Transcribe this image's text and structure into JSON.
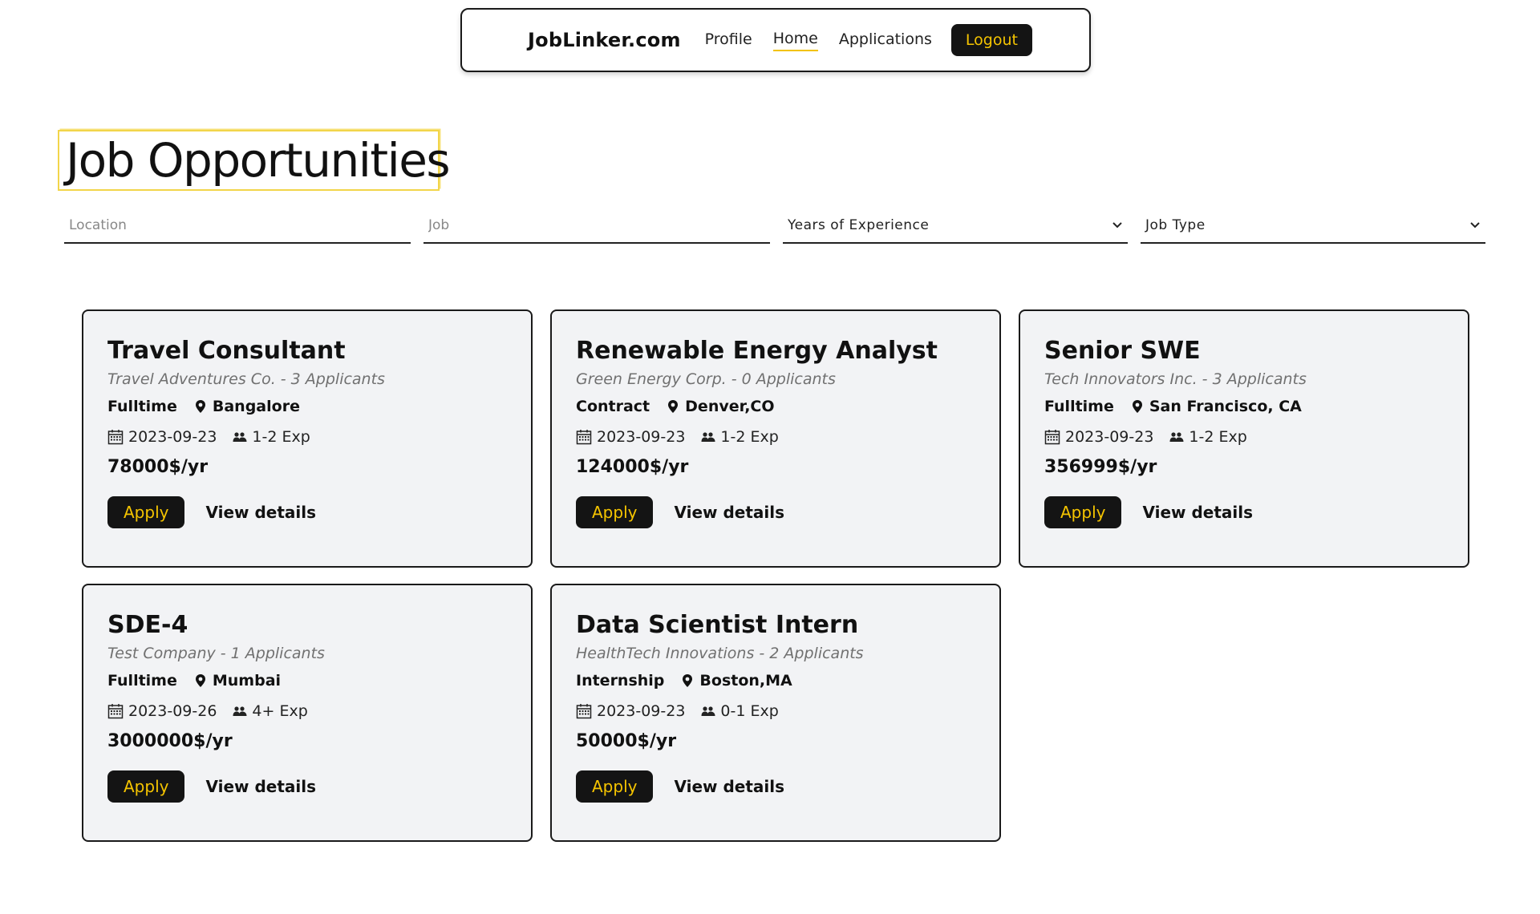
{
  "nav": {
    "brand": "JobLinker.com",
    "links": [
      "Profile",
      "Home",
      "Applications"
    ],
    "active": "Home",
    "logout": "Logout"
  },
  "page_title": "Job Opportunities",
  "filters": {
    "location_placeholder": "Location",
    "job_placeholder": "Job",
    "experience_label": "Years of Experience",
    "job_type_label": "Job Type"
  },
  "colors": {
    "accent": "#f5c400",
    "dark": "#141414",
    "card_bg": "#f2f3f5"
  },
  "jobs": [
    {
      "title": "Travel Consultant",
      "subtitle": "Travel Adventures Co. - 3 Applicants",
      "type": "Fulltime",
      "location": "Bangalore",
      "date": "2023-09-23",
      "exp": "1-2 Exp",
      "salary": "78000$/yr",
      "apply": "Apply",
      "details": "View details"
    },
    {
      "title": "Renewable Energy Analyst",
      "subtitle": "Green Energy Corp. - 0 Applicants",
      "type": "Contract",
      "location": "Denver,CO",
      "date": "2023-09-23",
      "exp": "1-2 Exp",
      "salary": "124000$/yr",
      "apply": "Apply",
      "details": "View details"
    },
    {
      "title": "Senior SWE",
      "subtitle": "Tech Innovators Inc. - 3 Applicants",
      "type": "Fulltime",
      "location": "San Francisco, CA",
      "date": "2023-09-23",
      "exp": "1-2 Exp",
      "salary": "356999$/yr",
      "apply": "Apply",
      "details": "View details"
    },
    {
      "title": "SDE-4",
      "subtitle": "Test Company - 1 Applicants",
      "type": "Fulltime",
      "location": "Mumbai",
      "date": "2023-09-26",
      "exp": "4+ Exp",
      "salary": "3000000$/yr",
      "apply": "Apply",
      "details": "View details"
    },
    {
      "title": "Data Scientist Intern",
      "subtitle": "HealthTech Innovations - 2 Applicants",
      "type": "Internship",
      "location": "Boston,MA",
      "date": "2023-09-23",
      "exp": "0-1 Exp",
      "salary": "50000$/yr",
      "apply": "Apply",
      "details": "View details"
    }
  ]
}
